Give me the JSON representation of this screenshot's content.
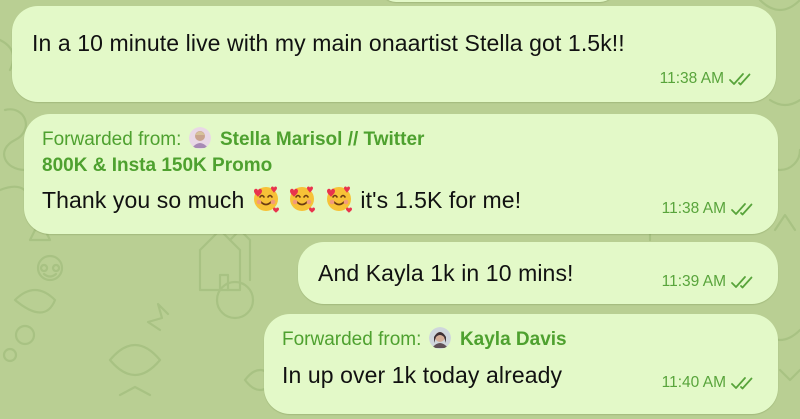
{
  "chat": {
    "messages": [
      {
        "text": "In a 10 minute live with my main onaartist Stella got 1.5k!!",
        "time": "11:38 AM"
      },
      {
        "forwarded_label": "Forwarded from:",
        "forwarded_from_line1": "Stella Marisol // Twitter",
        "forwarded_from_line2": "800K & Insta 150K Promo",
        "text_before": "Thank you so much",
        "emojis": [
          "smiling-face-with-hearts",
          "smiling-face-with-hearts",
          "smiling-face-with-hearts"
        ],
        "text_after": "it's 1.5K for me!",
        "time": "11:38 AM"
      },
      {
        "text": "And Kayla 1k in 10 mins!",
        "time": "11:39 AM"
      },
      {
        "forwarded_label": "Forwarded from:",
        "forwarded_from": "Kayla Davis",
        "text": "In up over 1k today already",
        "time": "11:40 AM"
      }
    ]
  },
  "colors": {
    "wallpaper": "#b9cf93",
    "bubble_outgoing": "#e3f9c8",
    "accent_green": "#4ea12f",
    "meta_green": "#58a43b"
  },
  "icons": {
    "read_status": "double-check-icon",
    "emoji": "smiling-face-with-hearts"
  }
}
